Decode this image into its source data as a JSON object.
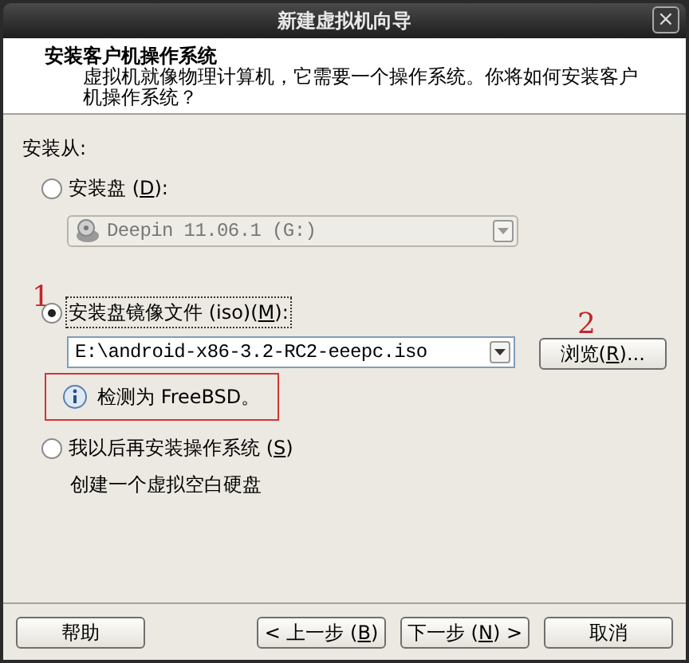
{
  "window": {
    "title": "新建虚拟机向导",
    "close": "×"
  },
  "header": {
    "title": "安装客户机操作系统",
    "description": "虚拟机就像物理计算机，它需要一个操作系统。你将如何安装客户机操作系统？"
  },
  "install_from": {
    "label": "安装从:",
    "options": [
      {
        "kind": "disc",
        "before": "安装盘 (",
        "key": "D",
        "after": "):",
        "selected": false,
        "value": "Deepin 11.06.1 (G:)",
        "disabled": true
      },
      {
        "kind": "iso",
        "before": "安装盘镜像文件 (iso)(",
        "key": "M",
        "after": "):",
        "selected": true,
        "value": "E:\\android-x86-3.2-RC2-eeepc.iso",
        "browse": {
          "before": "浏览(",
          "key": "R",
          "after": ")..."
        },
        "info": "检测为 FreeBSD。"
      },
      {
        "kind": "later",
        "before": "我以后再安装操作系统 (",
        "key": "S",
        "after": ")",
        "selected": false,
        "note": "创建一个虚拟空白硬盘"
      }
    ]
  },
  "annotations": [
    "1",
    "2"
  ],
  "buttons": [
    {
      "before": "帮助"
    },
    {
      "before": "< 上一步 (",
      "key": "B",
      "after": ")"
    },
    {
      "before": "下一步 (",
      "key": "N",
      "after": ") >"
    },
    {
      "before": "取消"
    }
  ]
}
